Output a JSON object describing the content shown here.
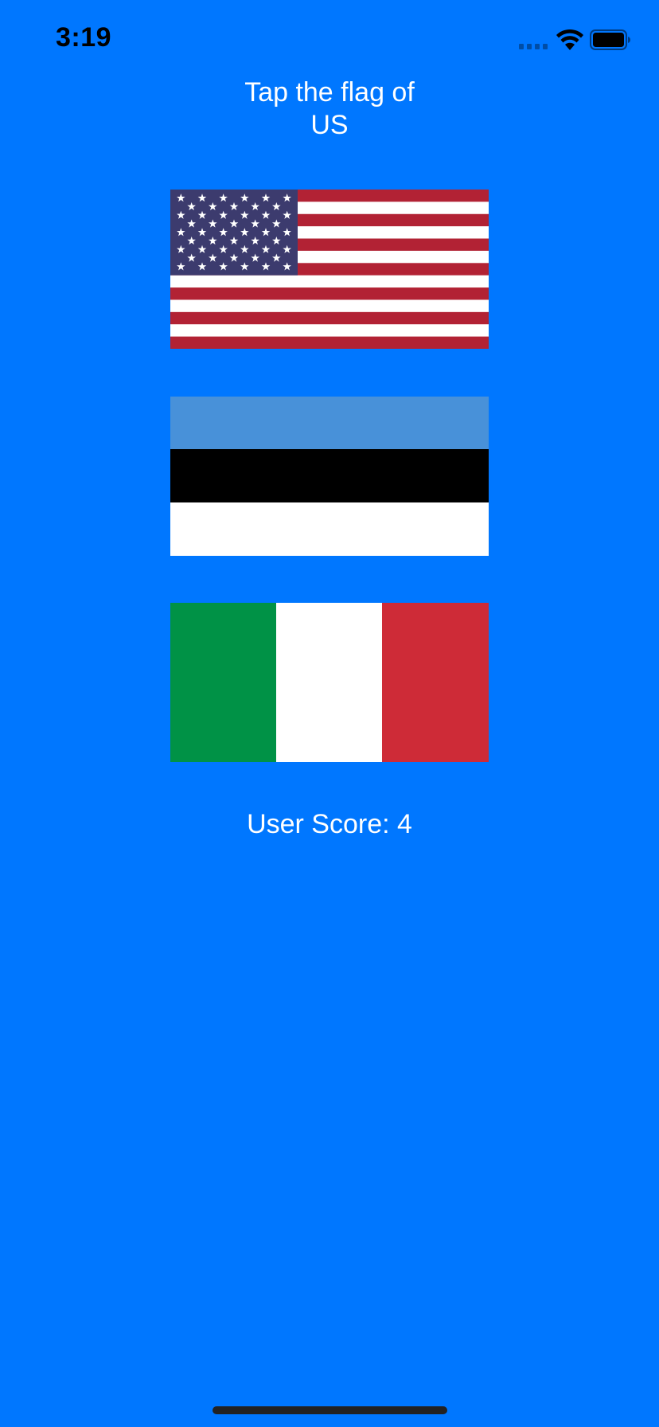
{
  "status_bar": {
    "time": "3:19",
    "icons": [
      "signal-icon",
      "wifi-icon",
      "battery-icon"
    ]
  },
  "prompt": {
    "line1": "Tap the flag of",
    "line2": "US"
  },
  "flags": [
    {
      "country": "US",
      "icon": "us-flag-icon"
    },
    {
      "country": "Estonia",
      "icon": "estonia-flag-icon"
    },
    {
      "country": "Italy",
      "icon": "italy-flag-icon"
    }
  ],
  "score": {
    "label": "User Score: 4"
  },
  "colors": {
    "background": "#0077FF",
    "text": "#FFFFFF",
    "us_red": "#B22234",
    "us_blue": "#3C3B6E",
    "estonia_blue": "#4891D9",
    "italy_green": "#009246",
    "italy_red": "#CE2B37"
  }
}
